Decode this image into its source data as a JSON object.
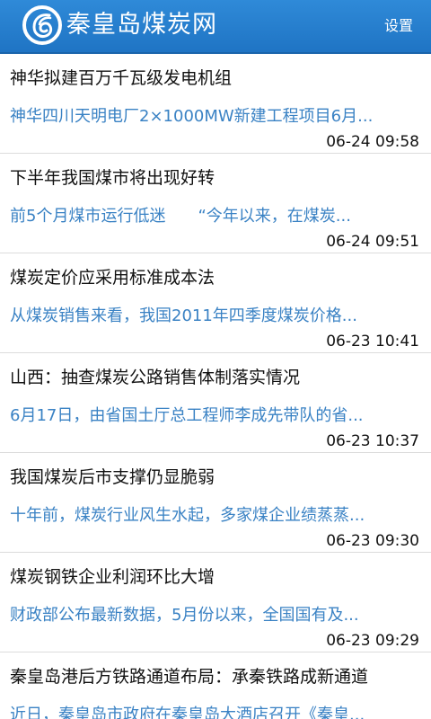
{
  "header": {
    "title": "秦皇岛煤炭网",
    "settings_label": "设置",
    "logo_icon": "coal-network-logo-icon",
    "accent_color": "#1f74c4"
  },
  "news": [
    {
      "title": "神华拟建百万千瓦级发电机组",
      "summary": "神华四川天明电厂2×1000MW新建工程项目6月...",
      "time": "06-24 09:58"
    },
    {
      "title": "下半年我国煤市将出现好转",
      "summary": " 前5个月煤市运行低迷　　“今年以来，在煤炭...",
      "time": "06-24 09:51"
    },
    {
      "title": "煤炭定价应采用标准成本法",
      "summary": " 从煤炭销售来看，我国2011年四季度煤炭价格...",
      "time": "06-23 10:41"
    },
    {
      "title": "山西：抽查煤炭公路销售体制落实情况",
      "summary": " 6月17日，由省国土厅总工程师李成先带队的省...",
      "time": "06-23 10:37"
    },
    {
      "title": "我国煤炭后市支撑仍显脆弱",
      "summary": "十年前，煤炭行业风生水起，多家煤企业绩蒸蒸...",
      "time": "06-23 09:30"
    },
    {
      "title": "煤炭钢铁企业利润环比大增",
      "summary": " 财政部公布最新数据，5月份以来，全国国有及...",
      "time": "06-23 09:29"
    },
    {
      "title": "秦皇岛港后方铁路通道布局：承秦铁路成新通道",
      "summary": "近日，秦皇岛市政府在秦皇岛大酒店召开《秦皇...",
      "time": ""
    }
  ]
}
